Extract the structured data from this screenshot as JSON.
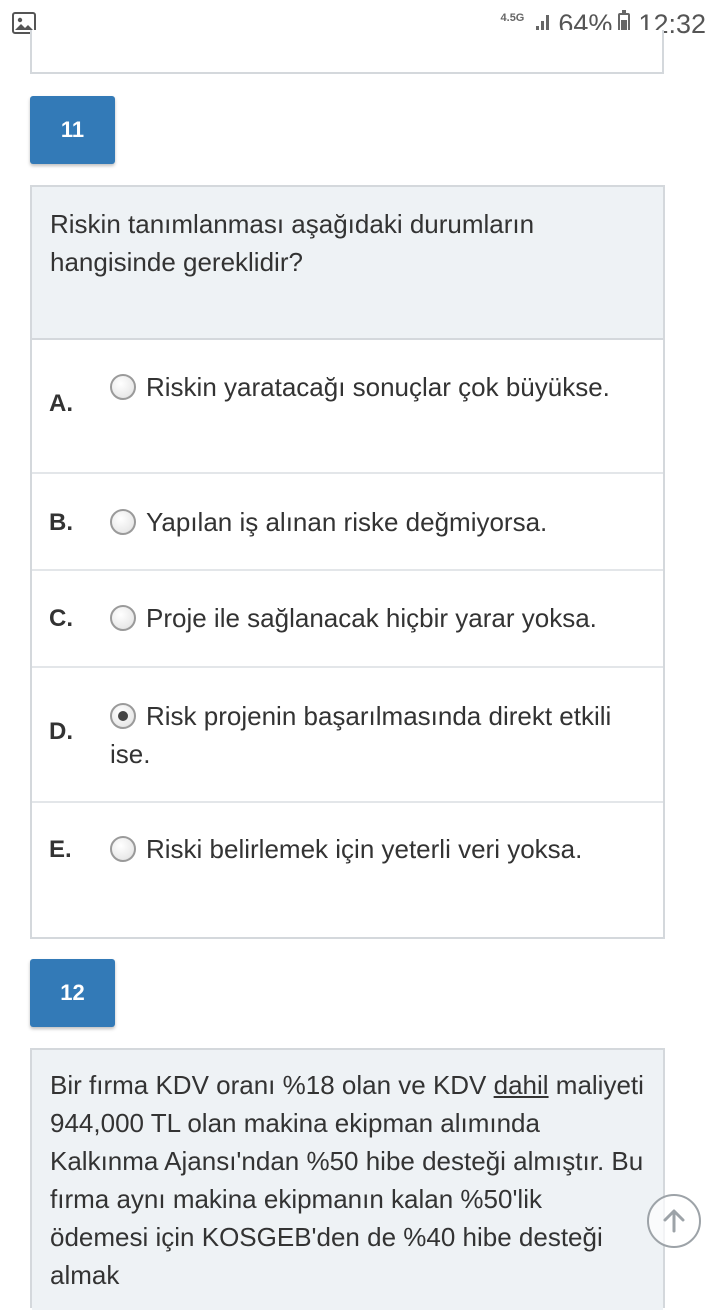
{
  "status_bar": {
    "network": "4.5G",
    "battery_percent": "64%",
    "battery_level": 0.64,
    "time": "12:32",
    "left_icon": "gallery-icon"
  },
  "questions": [
    {
      "number": "11",
      "text": "Riskin tanımlanması aşağıdaki durumların hangisinde gereklidir?",
      "options": [
        {
          "letter": "A.",
          "text": "Riskin yaratacağı sonuçlar çok büyükse.",
          "selected": false
        },
        {
          "letter": "B.",
          "text": "Yapılan iş alınan riske değmiyorsa.",
          "selected": false
        },
        {
          "letter": "C.",
          "text": "Proje ile sağlanacak hiçbir yarar yoksa.",
          "selected": false
        },
        {
          "letter": "D.",
          "text": "Risk projenin başarılmasında direkt etkili ise.",
          "selected": true
        },
        {
          "letter": "E.",
          "text": "Riski belirlemek için yeterli veri yoksa.",
          "selected": false
        }
      ]
    },
    {
      "number": "12",
      "text_before_underline": "Bir fırma KDV oranı %18 olan ve KDV ",
      "text_underlined": "dahil",
      "text_after_underline": " maliyeti 944,000 TL olan makina ekipman alımında Kalkınma Ajansı'ndan %50 hibe desteği almıştır. Bu fırma aynı makina ekipmanın kalan %50'lik ödemesi için KOSGEB'den de %40 hibe desteği almak"
    }
  ],
  "colors": {
    "badge": "#337ab7",
    "question_bg": "#eef2f5",
    "border": "#d4d8dc"
  },
  "scroll_button_icon": "arrow-up-icon"
}
